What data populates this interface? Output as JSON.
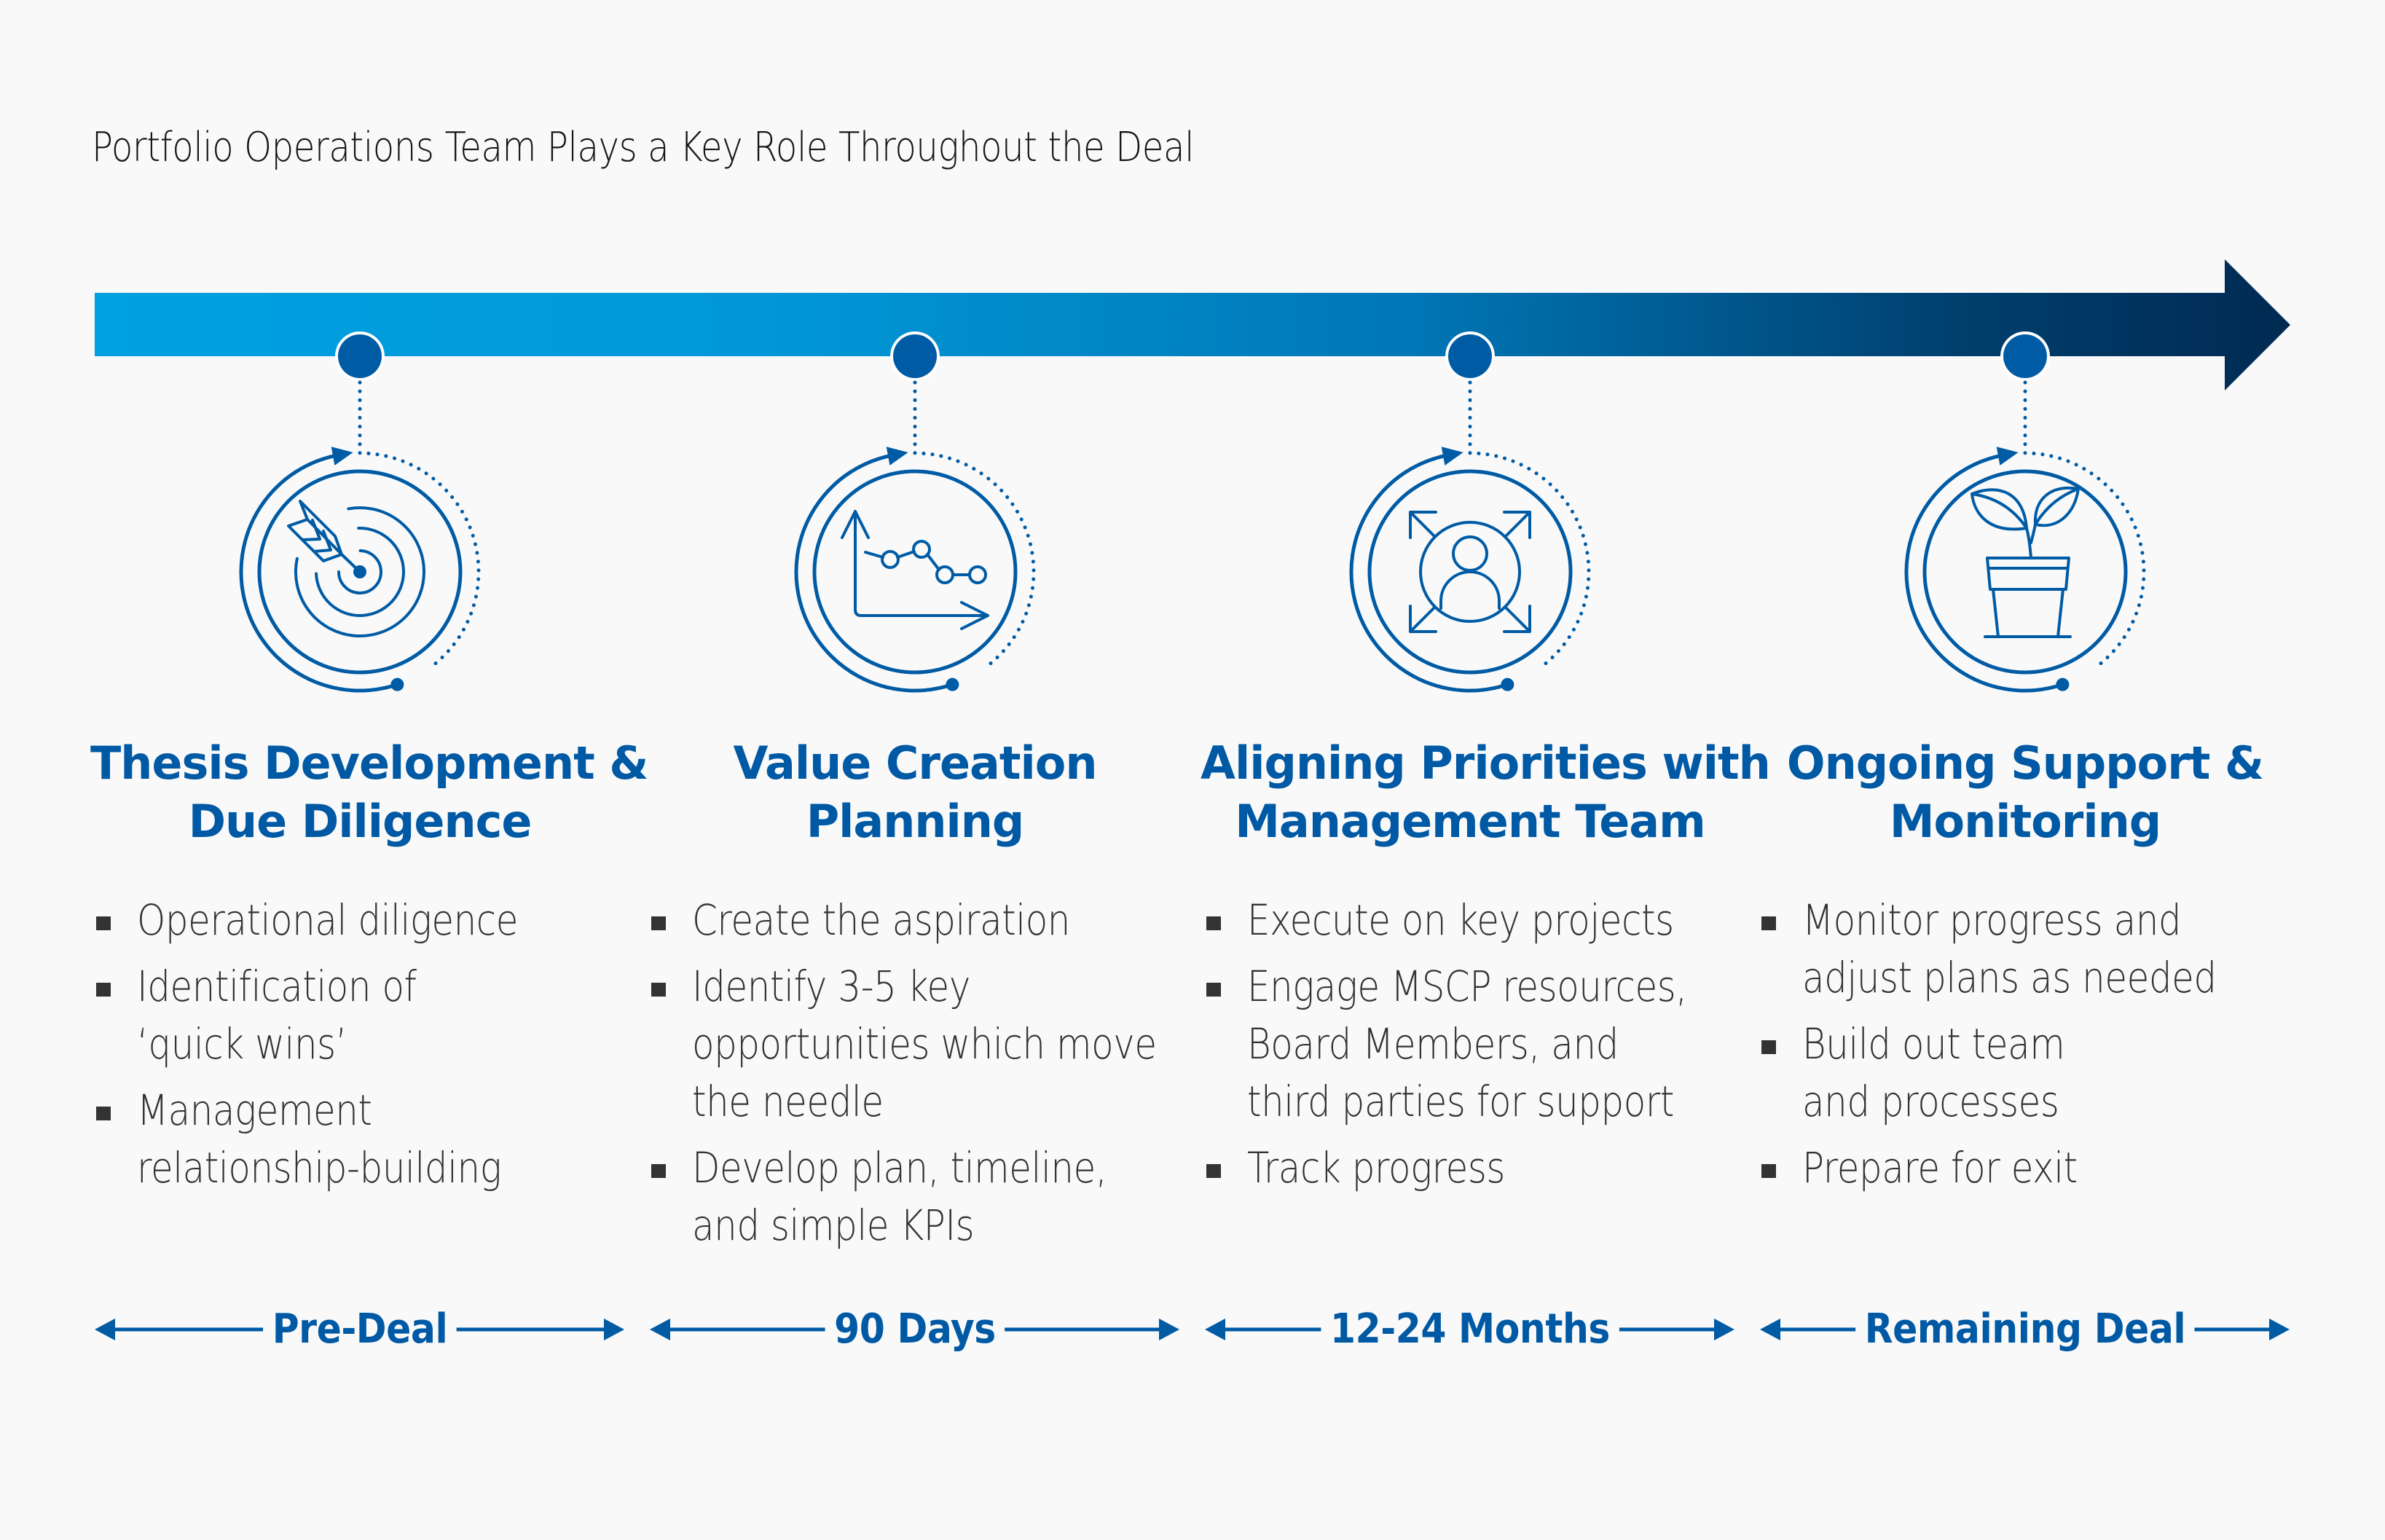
{
  "title": "Portfolio Operations Team Plays a Key Role Throughout the Deal",
  "colors": {
    "bar_start": "#00a1e1",
    "bar_mid": "#0077b6",
    "bar_end": "#002a52",
    "accent": "#0059a4",
    "dot": "#005ba5",
    "bullet_text": "#333333",
    "background": "#f9f9f9"
  },
  "stages": [
    {
      "icon": "target-arrow-icon",
      "heading": [
        "Thesis Development &",
        "Due Diligence"
      ],
      "bullets": [
        [
          "Operational diligence"
        ],
        [
          "Identification of",
          "‘quick wins’"
        ],
        [
          "Management",
          "relationship-building"
        ]
      ],
      "period": "Pre-Deal"
    },
    {
      "icon": "line-chart-icon",
      "heading": [
        "Value Creation",
        "Planning"
      ],
      "bullets": [
        [
          "Create the aspiration"
        ],
        [
          "Identify 3-5 key",
          "opportunities which move",
          "the needle"
        ],
        [
          "Develop plan, timeline,",
          "and simple KPIs"
        ]
      ],
      "period": "90 Days"
    },
    {
      "icon": "person-expand-icon",
      "heading": [
        "Aligning Priorities with",
        "Management Team"
      ],
      "bullets": [
        [
          "Execute on key projects"
        ],
        [
          "Engage MSCP resources,",
          "Board Members, and",
          "third parties for support"
        ],
        [
          "Track progress"
        ]
      ],
      "period": "12-24 Months"
    },
    {
      "icon": "potted-plant-icon",
      "heading": [
        "Ongoing Support &",
        "Monitoring"
      ],
      "bullets": [
        [
          "Monitor progress and",
          "adjust plans as needed"
        ],
        [
          "Build out team",
          "and processes"
        ],
        [
          "Prepare for exit"
        ]
      ],
      "period": "Remaining Deal"
    }
  ]
}
